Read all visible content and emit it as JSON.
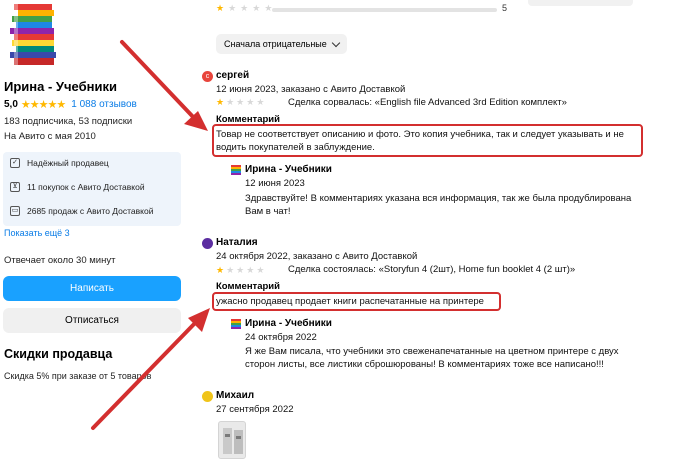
{
  "seller": {
    "name": "Ирина - Учебники",
    "rating": "5,0",
    "reviews_link": "1 088 отзывов",
    "followers": "183 подписчика, 53 подписки",
    "since": "На Авито с мая 2010",
    "badges": [
      {
        "icon": "shield-check-icon",
        "label": "Надёжный продавец"
      },
      {
        "icon": "cart-icon",
        "label": "11 покупок с Авито Доставкой"
      },
      {
        "icon": "truck-icon",
        "label": "2685 продаж с Авито Доставкой"
      }
    ],
    "show_more": "Показать ещё 3",
    "response_time": "Отвечает около 30 минут",
    "write_button": "Написать",
    "unsubscribe_button": "Отписаться",
    "discounts_title": "Скидки продавца",
    "discounts_text": "Скидка 5% при заказе от 5 товаров"
  },
  "rating_bar": {
    "filled_stars": 1,
    "count": "5"
  },
  "sort": {
    "label": "Сначала отрицательные"
  },
  "reviews": [
    {
      "author": "сергей",
      "avatar_letter": "с",
      "avatar_color": "#e8453c",
      "date_line": "12 июня 2023, заказано с Авито Доставкой",
      "stars": 1,
      "deal": "Сделка сорвалась: «English file Advanced 3rd Edition комплект»",
      "comment_label": "Комментарий",
      "comment_line1": "Товар не соответствует описанию и фото. Это копия учебника, так и следует указывать и не",
      "comment_line2": "водить покупателей в заблуждение.",
      "reply": {
        "author": "Ирина - Учебники",
        "date": "12 июня 2023",
        "line1": "Здравствуйте! В комментариях указана вся информация, так же была продублирована",
        "line2": "Вам в чат!"
      }
    },
    {
      "author": "Наталия",
      "avatar_color": "#5b2da0",
      "date_line": "24 октября 2022, заказано с Авито Доставкой",
      "stars": 1,
      "deal": "Сделка состоялась: «Storyfun 4 (2шт), Home fun booklet 4 (2 шт)»",
      "comment_label": "Комментарий",
      "comment_line1": "ужасно продавец продает книги распечатанные на принтере",
      "reply": {
        "author": "Ирина - Учебники",
        "date": "24 октября 2022",
        "line1": "Я же Вам писала, что учебники это свеженапечатанные на цветном принтере с двух",
        "line2": "сторон листы, все листики сброшюрованы! В комментариях тоже все написано!!!"
      }
    },
    {
      "author": "Михаил",
      "avatar_color": "#f0c419",
      "date_line": "27 сентября 2022"
    }
  ],
  "colors": {
    "accent": "#19a1ff",
    "link": "#0a7ce6",
    "star": "#ffb800",
    "highlight": "#d32f2f"
  }
}
